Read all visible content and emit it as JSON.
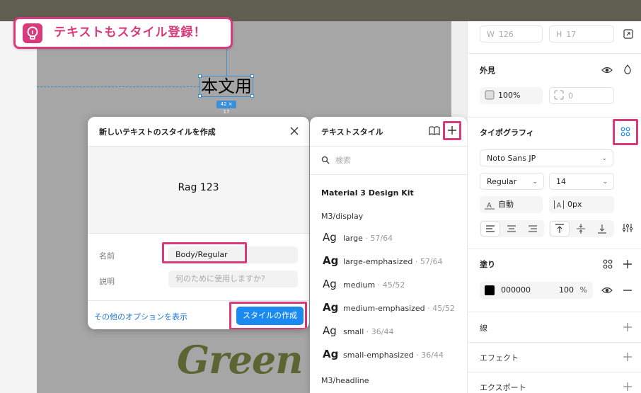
{
  "tip": {
    "text": "テキストもスタイル登録！",
    "icon": "lightbulb-icon"
  },
  "canvas": {
    "selected_text": "本文用",
    "size_badge": "42 × 17",
    "brand_text": "Green Cafe"
  },
  "dialog": {
    "title": "新しいテキストのスタイルを作成",
    "preview_text": "Rag 123",
    "name_label": "名前",
    "name_value": "Body/Regular",
    "desc_label": "説明",
    "desc_placeholder": "何のために使用しますか?",
    "more_options": "その他のオプションを表示",
    "create_button": "スタイルの作成"
  },
  "text_styles": {
    "title": "テキストスタイル",
    "search_placeholder": "検索",
    "group": "Material 3 Design Kit",
    "subgroup_display": "M3/display",
    "subgroup_headline": "M3/headline",
    "items": [
      {
        "ag": "Ag",
        "name": "large",
        "meta": " · 57/64",
        "bold": false
      },
      {
        "ag": "Ag",
        "name": "large-emphasized",
        "meta": " · 57/64",
        "bold": true
      },
      {
        "ag": "Ag",
        "name": "medium",
        "meta": " · 45/52",
        "bold": false
      },
      {
        "ag": "Ag",
        "name": "medium-emphasized",
        "meta": " · 45/52",
        "bold": true
      },
      {
        "ag": "Ag",
        "name": "small",
        "meta": " · 36/44",
        "bold": false
      },
      {
        "ag": "Ag",
        "name": "small-emphasized",
        "meta": " · 36/44",
        "bold": true
      }
    ]
  },
  "properties": {
    "w_label": "W",
    "w_value": "126",
    "h_label": "H",
    "h_value": "17",
    "appearance_title": "外見",
    "opacity": "100%",
    "radius": "0",
    "typography_title": "タイポグラフィ",
    "font_family": "Noto Sans JP",
    "font_weight": "Regular",
    "font_size": "14",
    "line_height": "自動",
    "letter_spacing": "0px",
    "fill_title": "塗り",
    "fill_hex": "000000",
    "fill_opacity": "100",
    "fill_percent": "%",
    "stroke_title": "線",
    "effects_title": "エフェクト",
    "export_title": "エクスポート"
  },
  "colors": {
    "accent_pink": "#d83a7c",
    "primary_blue": "#1a8af0",
    "selection_blue": "#3a8fd9"
  }
}
